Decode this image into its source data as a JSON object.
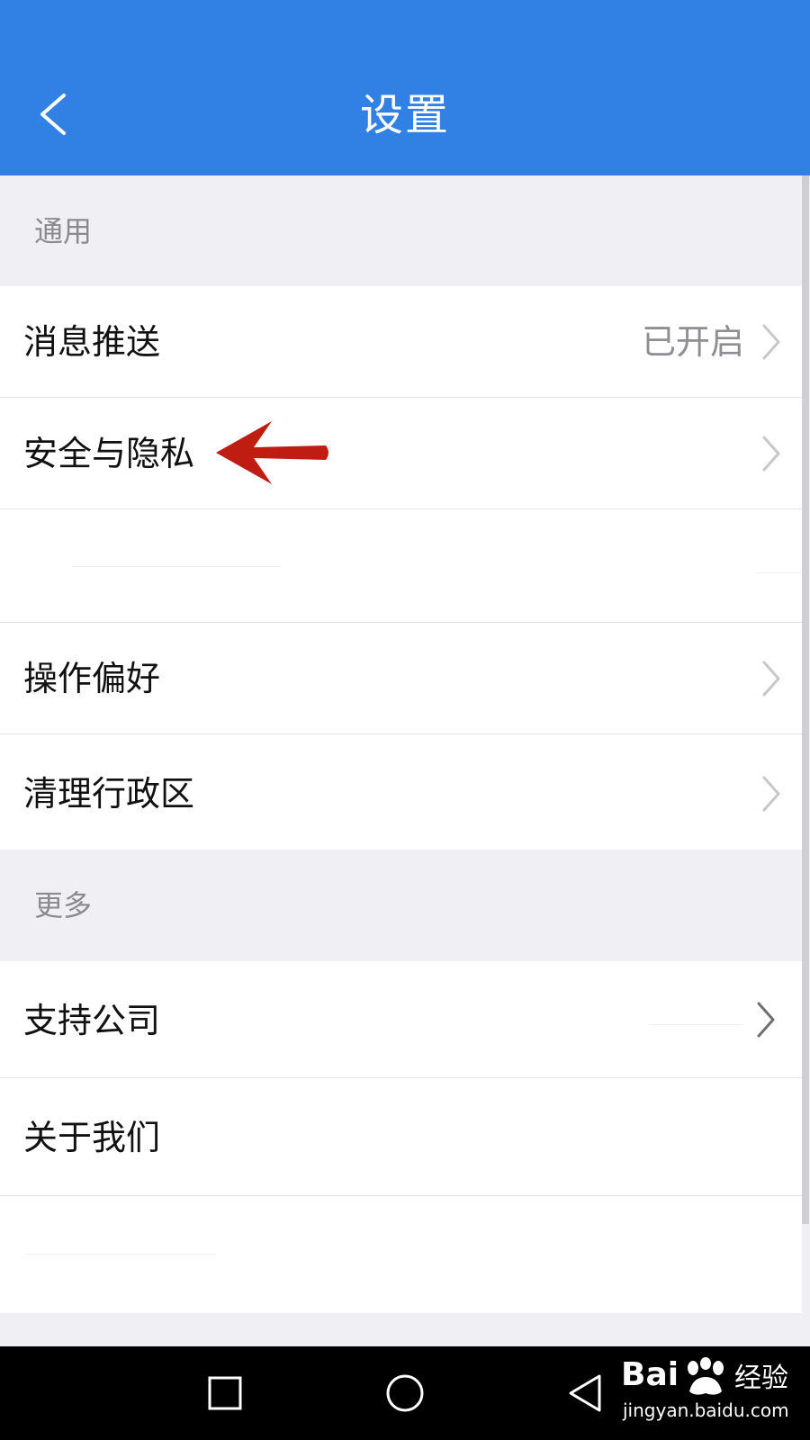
{
  "header": {
    "title": "设置",
    "back_icon": "chevron-left-icon",
    "background": "#3181e5"
  },
  "sections": {
    "general": {
      "title": "通用"
    },
    "more": {
      "title": "更多"
    }
  },
  "items": {
    "push": {
      "label": "消息推送",
      "value": "已开启"
    },
    "security": {
      "label": "安全与隐私"
    },
    "preferences": {
      "label": "操作偏好"
    },
    "clear_region": {
      "label": "清理行政区"
    },
    "support": {
      "label": "支持公司"
    },
    "about": {
      "label": "关于我们"
    }
  },
  "annotation": {
    "color": "#c01d12"
  },
  "navbar": {
    "recent_icon": "square-icon",
    "home_icon": "circle-icon",
    "back_icon": "triangle-back-icon"
  },
  "watermark": {
    "brand_latin": "Bai",
    "brand_cn": "经验",
    "url": "jingyan.baidu.com"
  }
}
